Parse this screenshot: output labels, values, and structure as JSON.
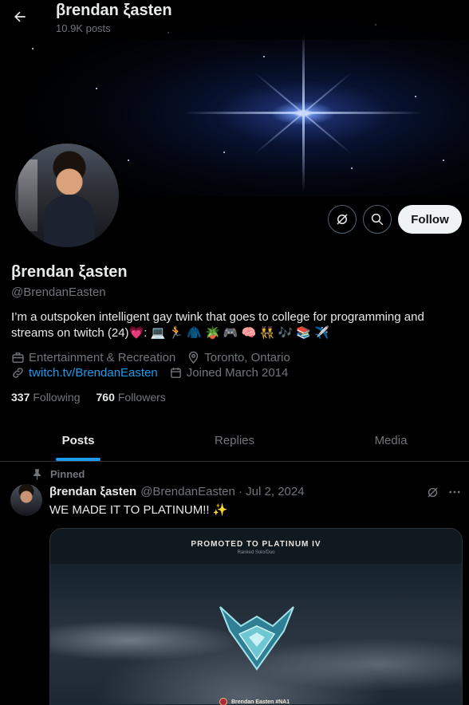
{
  "header": {
    "name": "βrendan ξasten",
    "post_count": "10.9K posts"
  },
  "profile": {
    "display_name": "βrendan ξasten",
    "handle": "@BrendanEasten",
    "bio": "I’m a outspoken intelligent gay twink that goes to college for programming and streams on twitch (24)💗: 💻 🏃 🧥 🪴 🎮 🧠 👯 🎶 📚 ✈️",
    "category": "Entertainment & Recreation",
    "location": "Toronto, Ontario",
    "website": "twitch.tv/BrendanEasten",
    "joined": "Joined March 2014",
    "following_count": "337",
    "following_label": "Following",
    "followers_count": "760",
    "followers_label": "Followers",
    "follow_button": "Follow"
  },
  "tabs": [
    {
      "label": "Posts",
      "active": true
    },
    {
      "label": "Replies",
      "active": false
    },
    {
      "label": "Media",
      "active": false
    }
  ],
  "post": {
    "pinned_label": "Pinned",
    "author_name": "βrendan ξasten",
    "meta": "@BrendanEasten · Jul 2, 2024",
    "text": "WE MADE IT TO PLATINUM!! ✨",
    "media": {
      "title": "PROMOTED TO PLATINUM IV",
      "subtitle": "Ranked Solo/Duo",
      "player": "Brendan Easten #NA1"
    }
  },
  "colors": {
    "accent": "#1d9bf0",
    "secondary_text": "#71767b",
    "primary_text": "#e7e9ea"
  },
  "icons": [
    "back-arrow-icon",
    "grok-icon",
    "search-icon",
    "briefcase-icon",
    "location-pin-icon",
    "link-icon",
    "calendar-icon",
    "pin-icon",
    "more-icon"
  ]
}
